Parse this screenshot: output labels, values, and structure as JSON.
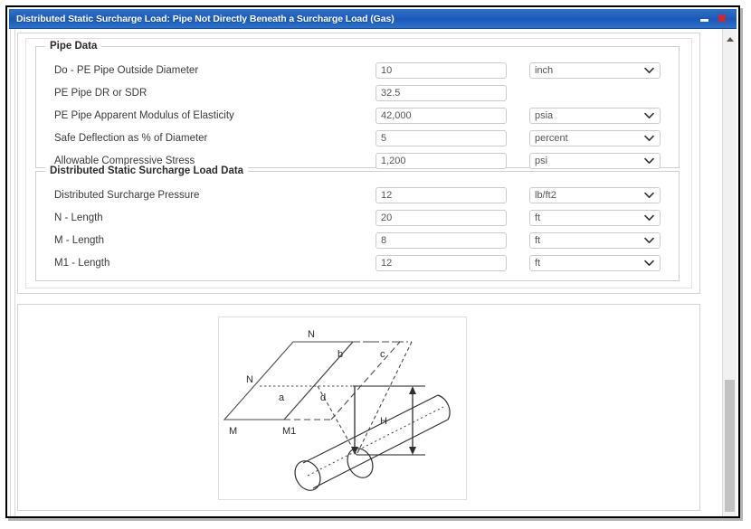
{
  "window": {
    "title": "Distributed Static Surcharge Load: Pipe Not Directly Beneath a Surcharge Load (Gas)",
    "minimize_label": "",
    "close_label": "✖",
    "title_bar_color": "#1f5fbe",
    "close_icon_color": "#e8201a"
  },
  "groups": [
    {
      "legend": "Pipe Data",
      "rows": [
        {
          "label": "Do - PE Pipe Outside Diameter",
          "value": "10",
          "unit": "inch",
          "has_unit": true
        },
        {
          "label": "PE Pipe DR or SDR",
          "value": "32.5",
          "unit": "",
          "has_unit": false
        },
        {
          "label": "PE Pipe Apparent Modulus of Elasticity",
          "value": "42,000",
          "unit": "psia",
          "has_unit": true
        },
        {
          "label": "Safe Deflection as % of Diameter",
          "value": "5",
          "unit": "percent",
          "has_unit": true
        },
        {
          "label": "Allowable Compressive Stress",
          "value": "1,200",
          "unit": "psi",
          "has_unit": true
        }
      ]
    },
    {
      "legend": "Distributed Static Surcharge Load Data",
      "rows": [
        {
          "label": "Distributed Surcharge Pressure",
          "value": "12",
          "unit": "lb/ft2",
          "has_unit": true
        },
        {
          "label": "N - Length",
          "value": "20",
          "unit": "ft",
          "has_unit": true
        },
        {
          "label": "M - Length",
          "value": "8",
          "unit": "ft",
          "has_unit": true
        },
        {
          "label": "M1 - Length",
          "value": "12",
          "unit": "ft",
          "has_unit": true
        }
      ]
    }
  ],
  "diagram": {
    "description": "Isometric sketch of a rectangular surcharge load area above a buried pipe that is offset from the load footprint",
    "labels": {
      "n_top": "N",
      "n_left": "N",
      "b": "b",
      "c": "c",
      "a": "a",
      "d": "d",
      "m": "M",
      "m1": "M1",
      "h": "H"
    }
  },
  "scrollbar": {
    "up_arrow": "▲",
    "thumb_color": "#c2c2c2"
  }
}
